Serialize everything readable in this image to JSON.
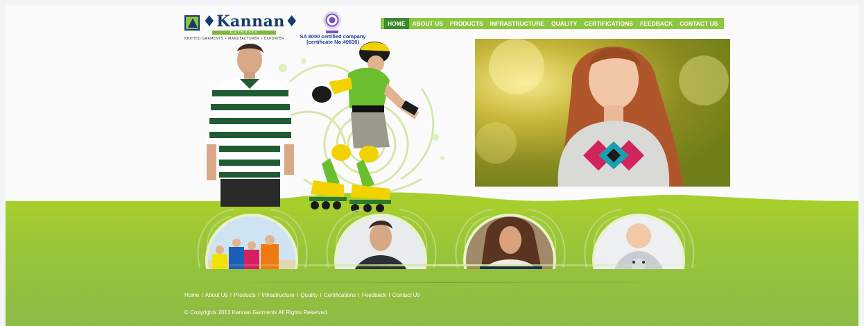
{
  "brand": {
    "name": "Kannan",
    "subtitle": "Garments",
    "tagline": "KNITTED GARMENTS • MANUFACTURER • EXPORTER"
  },
  "certification": {
    "line1": "SA 8000 certified company",
    "line2": "(certificate No:49830)"
  },
  "nav": [
    {
      "label": "HOME",
      "active": true
    },
    {
      "label": "ABOUT US"
    },
    {
      "label": "PRODUCTS"
    },
    {
      "label": "INFRASTRUCTURE"
    },
    {
      "label": "QUALITY"
    },
    {
      "label": "CERTIFICATIONS"
    },
    {
      "label": "FEEDBACK"
    },
    {
      "label": "CONTACT US"
    }
  ],
  "footer": {
    "links": [
      "Home",
      "About Us",
      "Products",
      "Infrastructure",
      "Quality",
      "Certifications",
      "Feedback",
      "Contact Us"
    ],
    "separator": "I",
    "copyright": "© Copyrights 2013 Kannan Garments All Rights Reserved"
  },
  "colors": {
    "nav_bg": "#8dc63f",
    "nav_active": "#3a8a2a",
    "band": "#98c43a",
    "brand_blue": "#173a6e",
    "cert_blue": "#1c3f97"
  }
}
